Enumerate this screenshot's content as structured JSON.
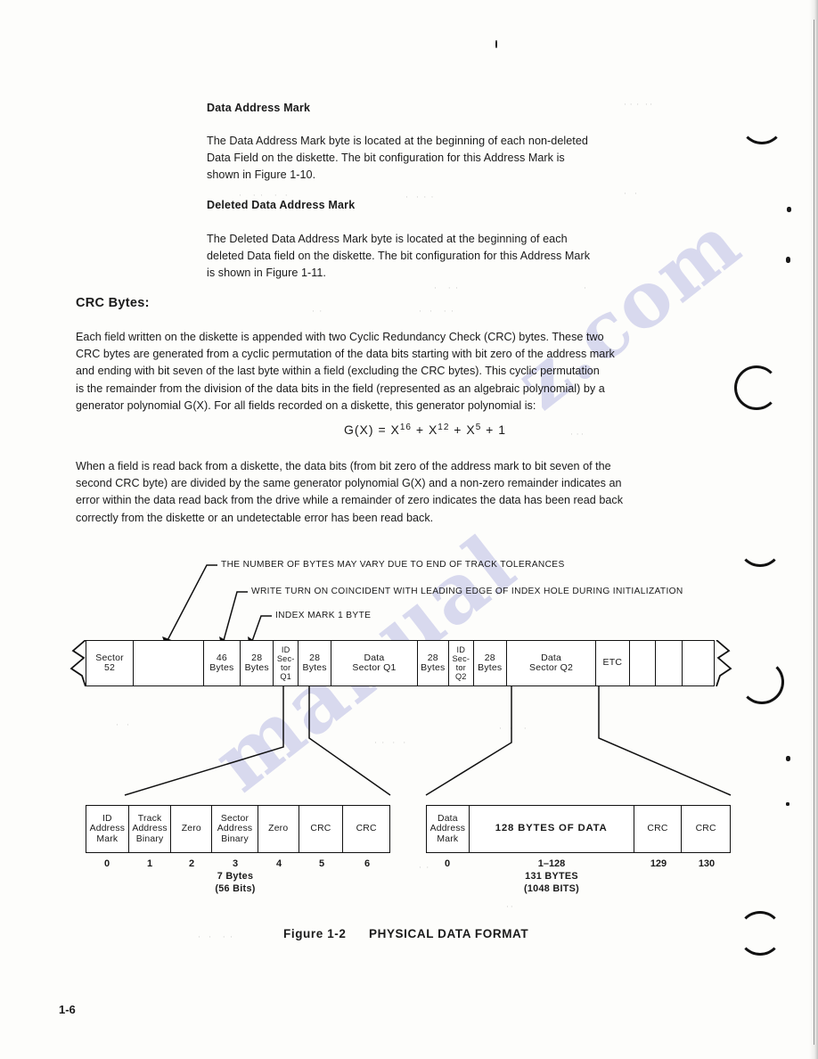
{
  "document": {
    "page_number": "1-6",
    "figure_caption_label": "Figure  1-2",
    "figure_caption_title": "PHYSICAL DATA FORMAT"
  },
  "sections": [
    {
      "heading": "Data Address Mark",
      "body": "The Data Address Mark byte is located at the beginning of each non-deleted\nData Field on the diskette.  The bit configuration for this Address Mark is\nshown in Figure 1-10."
    },
    {
      "heading": "Deleted Data Address Mark",
      "body": "The Deleted Data Address Mark byte is located at the beginning of each\ndeleted Data field on the diskette.  The bit configuration for this Address Mark\nis shown in Figure 1-11."
    }
  ],
  "crc": {
    "heading": "CRC Bytes:",
    "paragraph1": "Each field written on the diskette is appended with two Cyclic Redundancy Check (CRC) bytes.  These two\nCRC bytes are generated from a cyclic permutation of the data bits starting with bit zero of the address mark\nand ending with bit seven of the last byte within a field (excluding the CRC bytes).  This cyclic permutation\nis the remainder from the division of the data bits in the field (represented as an algebraic polynomial) by a\ngenerator polynomial G(X).  For all fields recorded on a diskette, this generator polynomial is:",
    "formula": {
      "lhs": "G(X) = X",
      "exp1": "16",
      "op1": " + ",
      "term2": "X",
      "exp2": "12",
      "op2": " + ",
      "term3": "X",
      "exp3": "5",
      "op3": " + ",
      "term4": "1"
    },
    "paragraph2": "When a field is read back from a diskette, the data bits (from bit zero of the address mark to bit seven of the\nsecond CRC byte) are divided by the same generator polynomial G(X) and a non-zero remainder indicates an\nerror within the data read back from the drive while a remainder of zero indicates the data has been read back\ncorrectly from the diskette or an undetectable error has been read back."
  },
  "figure": {
    "callouts": [
      "THE NUMBER OF BYTES MAY VARY DUE TO END OF TRACK TOLERANCES",
      "WRITE TURN ON COINCIDENT WITH LEADING EDGE OF INDEX HOLE DURING INITIALIZATION",
      "INDEX MARK 1 BYTE"
    ],
    "track_cells": [
      {
        "line1": "Sector",
        "line2": "52"
      },
      {
        "line1": "",
        "line2": ""
      },
      {
        "line1": "46",
        "line2": "Bytes"
      },
      {
        "line1": "28",
        "line2": "Bytes"
      },
      {
        "line1": "ID",
        "line2": "Sec-",
        "line3": "tor",
        "line4": "Q1"
      },
      {
        "line1": "28",
        "line2": "Bytes"
      },
      {
        "line1": "Data",
        "line2": "Sector Q1"
      },
      {
        "line1": "28",
        "line2": "Bytes"
      },
      {
        "line1": "ID",
        "line2": "Sec-",
        "line3": "tor",
        "line4": "Q2"
      },
      {
        "line1": "28",
        "line2": "Bytes"
      },
      {
        "line1": "Data",
        "line2": "Sector Q2"
      },
      {
        "line1": "ETC",
        "line2": ""
      },
      {
        "line1": "",
        "line2": ""
      },
      {
        "line1": "",
        "line2": ""
      },
      {
        "line1": "",
        "line2": ""
      }
    ],
    "id_field": {
      "cells": [
        {
          "line1": "ID",
          "line2": "Address",
          "line3": "Mark"
        },
        {
          "line1": "Track",
          "line2": "Address",
          "line3": "Binary"
        },
        {
          "line1": "Zero",
          "line2": "",
          "line3": ""
        },
        {
          "line1": "Sector",
          "line2": "Address",
          "line3": "Binary"
        },
        {
          "line1": "Zero",
          "line2": "",
          "line3": ""
        },
        {
          "line1": "CRC",
          "line2": "",
          "line3": ""
        },
        {
          "line1": "CRC",
          "line2": "",
          "line3": ""
        }
      ],
      "indices": [
        "0",
        "1",
        "2",
        "3",
        "4",
        "5",
        "6"
      ],
      "summary_line1": "7 Bytes",
      "summary_line2": "(56 Bits)"
    },
    "data_field": {
      "cells": [
        {
          "line1": "Data",
          "line2": "Address",
          "line3": "Mark"
        },
        {
          "line1": "128 BYTES OF DATA",
          "line2": "",
          "line3": ""
        },
        {
          "line1": "CRC",
          "line2": "",
          "line3": ""
        },
        {
          "line1": "CRC",
          "line2": "",
          "line3": ""
        }
      ],
      "indices": [
        "0",
        "1–128",
        "129",
        "130"
      ],
      "summary_line1": "131 BYTES",
      "summary_line2": "(1048 BITS)"
    }
  }
}
